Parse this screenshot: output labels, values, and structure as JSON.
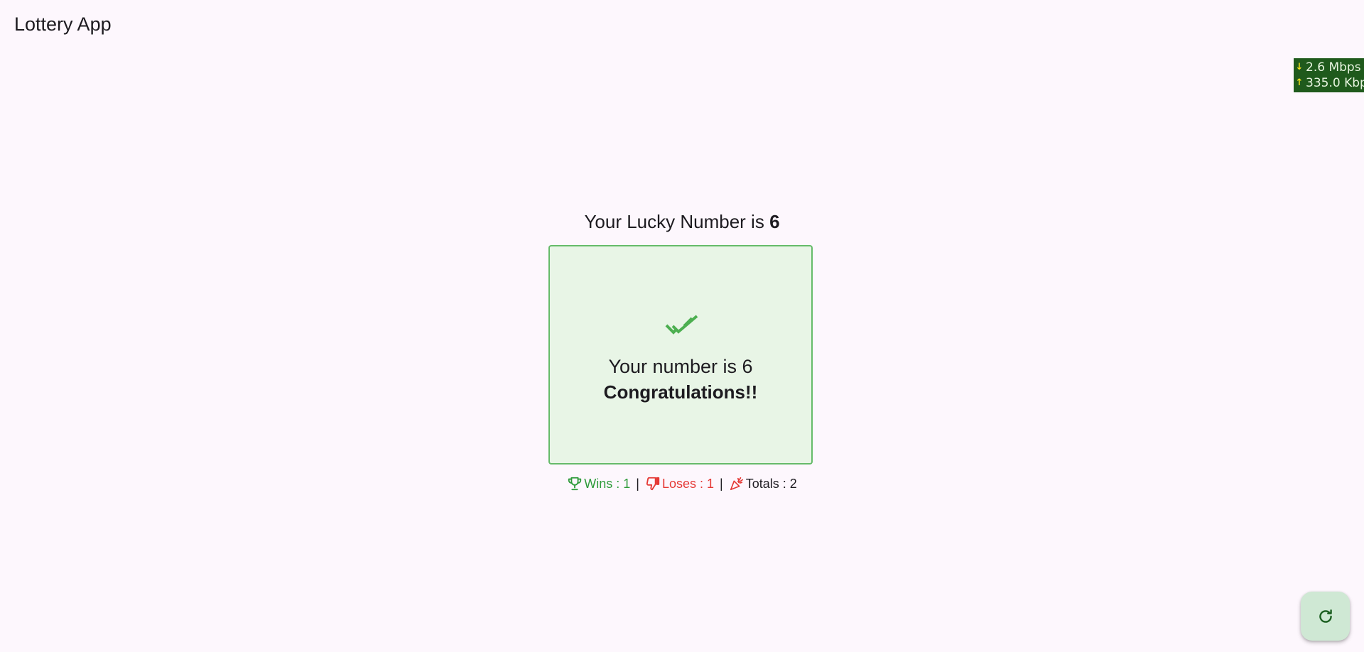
{
  "app": {
    "title": "Lottery App"
  },
  "network": {
    "download": "2.6 Mbps",
    "upload": "335.0 Kbp",
    "arrow_down": "↓",
    "arrow_up": "↑"
  },
  "lucky": {
    "prefix": "Your Lucky Number is ",
    "number": "6"
  },
  "result": {
    "message": "Your number is 6",
    "status": "Congratulations!!",
    "icon": "double-check-icon"
  },
  "stats": {
    "wins": "Wins : 1",
    "loses": "Loses : 1",
    "totals": "Totals : 2",
    "separator": "|"
  },
  "actions": {
    "refresh_icon": "refresh-icon"
  },
  "colors": {
    "background": "#fdf7fd",
    "success": "#2e9b3a",
    "success_border": "#66bb6a",
    "success_bg": "#e8f5e6",
    "error": "#e53935",
    "fab_bg": "#cfe8d4"
  }
}
